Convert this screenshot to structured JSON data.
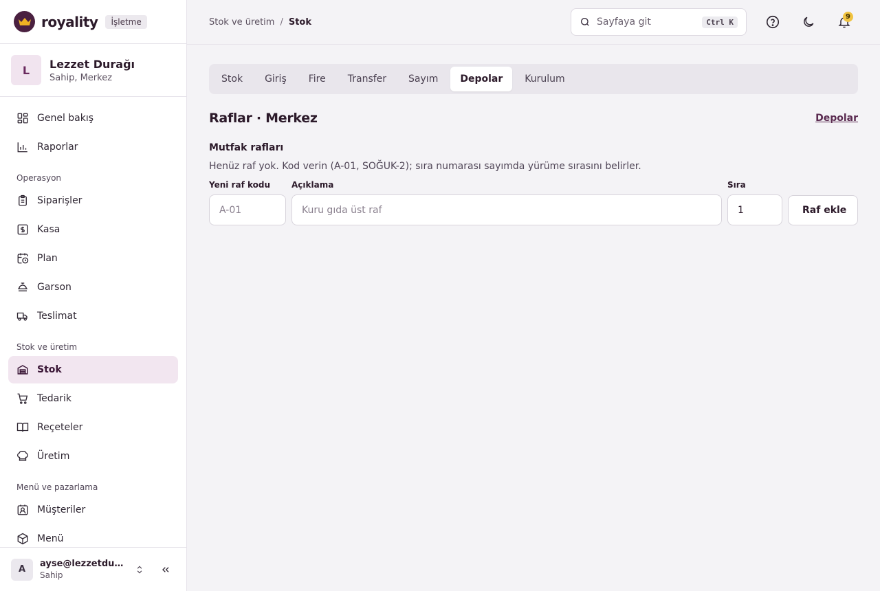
{
  "brand": {
    "name": "royality",
    "badge": "İşletme"
  },
  "org": {
    "initial": "L",
    "name": "Lezzet Durağı",
    "role": "Sahip, Merkez"
  },
  "nav": {
    "top": [
      {
        "label": "Genel bakış",
        "icon": "layout-grid-icon"
      },
      {
        "label": "Raporlar",
        "icon": "bar-chart-icon"
      }
    ],
    "sections": [
      {
        "title": "Operasyon",
        "items": [
          {
            "label": "Siparişler",
            "icon": "clipboard-icon"
          },
          {
            "label": "Kasa",
            "icon": "cash-icon"
          },
          {
            "label": "Plan",
            "icon": "calendar-clock-icon"
          },
          {
            "label": "Garson",
            "icon": "waiter-icon"
          },
          {
            "label": "Teslimat",
            "icon": "truck-icon"
          }
        ]
      },
      {
        "title": "Stok ve üretim",
        "items": [
          {
            "label": "Stok",
            "icon": "warehouse-icon",
            "active": true
          },
          {
            "label": "Tedarik",
            "icon": "cart-icon"
          },
          {
            "label": "Reçeteler",
            "icon": "book-icon"
          },
          {
            "label": "Üretim",
            "icon": "chef-hat-icon"
          }
        ]
      },
      {
        "title": "Menü ve pazarlama",
        "items": [
          {
            "label": "Müşteriler",
            "icon": "contact-icon"
          },
          {
            "label": "Menü",
            "icon": "package-icon"
          }
        ]
      }
    ]
  },
  "user": {
    "initial": "A",
    "email": "ayse@lezzetduragi.com",
    "role": "Sahip"
  },
  "breadcrumb": {
    "parent": "Stok ve üretim",
    "separator": "/",
    "current": "Stok"
  },
  "search": {
    "placeholder": "Sayfaya git",
    "shortcut": "Ctrl K"
  },
  "notifications": {
    "count": "9"
  },
  "tabs": [
    "Stok",
    "Giriş",
    "Fire",
    "Transfer",
    "Sayım",
    "Depolar",
    "Kurulum"
  ],
  "active_tab": "Depolar",
  "section": {
    "title": "Raflar · Merkez",
    "link": "Depolar"
  },
  "shelves": {
    "title": "Mutfak rafları",
    "empty_text": "Henüz raf yok. Kod verin (A-01, SOĞUK-2); sıra numarası sayımda yürüme sırasını belirler.",
    "code_label": "Yeni raf kodu",
    "code_placeholder": "A-01",
    "desc_label": "Açıklama",
    "desc_placeholder": "Kuru gıda üst raf",
    "order_label": "Sıra",
    "order_value": "1",
    "add_button": "Raf ekle"
  },
  "colors": {
    "accent": "#5a2a50",
    "active_bg": "#f2e6f0",
    "badge": "#f0c341"
  }
}
